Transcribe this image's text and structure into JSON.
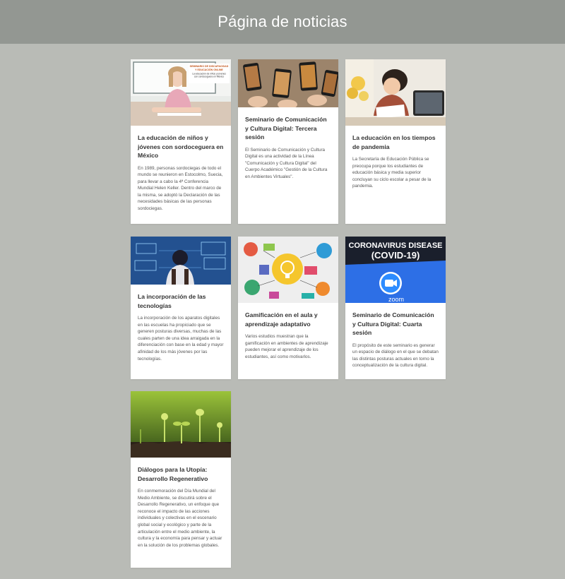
{
  "page": {
    "title": "Página de noticias"
  },
  "colors": {
    "header_bg": "#939792",
    "page_bg": "#b9bbb6",
    "card_bg": "#ffffff"
  },
  "cards": [
    {
      "image": "girl-reading-photo",
      "image_caption": [
        "SEMINARIO DE DISCAPACIDAD",
        "Y EDUCACIÓN ONLINE",
        "La educación de niños y jóvenes",
        "con sordoceguera en México"
      ],
      "title": "La educación de niños y jóvenes con sordoceguera en México",
      "text": "En 1989, personas sordociegas de todo el mundo se reunieron en Estocolmo, Suecia, para llevar a cabo la 4ª Conferencia Mundial Helen Keller. Dentro del marco de la misma, se adoptó la Declaración de las necesidades básicas de las personas sordociegas."
    },
    {
      "image": "phones-food-photo",
      "title": "Seminario de Comunicación y Cultura Digital: Tercera sesión",
      "text": "El Seminario de Comunicación y Cultura Digital es una actividad de la Línea \"Comunicación y Cultura Digital\" del Cuerpo Académico \"Gestión de la Cultura en Ambientes Virtuales\"."
    },
    {
      "image": "child-tablet-photo",
      "title": "La educación en los tiempos de pandemia",
      "text": "La Secretaría de Educación Pública se preocupa porque los estudiantes de educación básica y media superior concluyan su ciclo escolar a pesar de la pandemia."
    },
    {
      "image": "boy-technology-photo",
      "title": "La incorporación de las tecnologías",
      "text": "La incorporación de los aparatos digitales en las escuelas ha propiciado que se generen posturas diversas, muchas de las cuales parten de una idea arraigada en la diferenciación con base en la edad y mayor afinidad de los más jóvenes por las tecnologías."
    },
    {
      "image": "gamification-illustration",
      "title": "Gamificación en el aula y aprendizaje adaptativo",
      "text": "Varios estudios muestran que la gamificación en ambientes de aprendizaje pueden mejorar el aprendizaje de los estudiantes, así como motivarlos."
    },
    {
      "image": "zoom-covid-photo",
      "image_caption": [
        "CORONAVIRUS DISEASE",
        "(COVID-19)",
        "zoom"
      ],
      "title": "Seminario de Comunicación y Cultura Digital: Cuarta sesión",
      "text": "El propósito de este seminario es generar un espacio de diálogo en el que se debatan las distintas posturas actuales en torno la conceptualización de la cultura digital."
    },
    {
      "image": "sprouts-photo",
      "title": "Diálogos para la Utopía: Desarrollo Regenerativo",
      "text": "En conmemoración del Día Mundial del Medio Ambiente, se discutirá sobre el Desarrollo Regenerativo, un enfoque que reconoce el impacto de las acciones individuales y colectivas en el escenario global social y ecológico y parte de la articulación entre el medio ambiente, la cultura y la economía para pensar y actuar en la solución de los problemas globales."
    }
  ]
}
